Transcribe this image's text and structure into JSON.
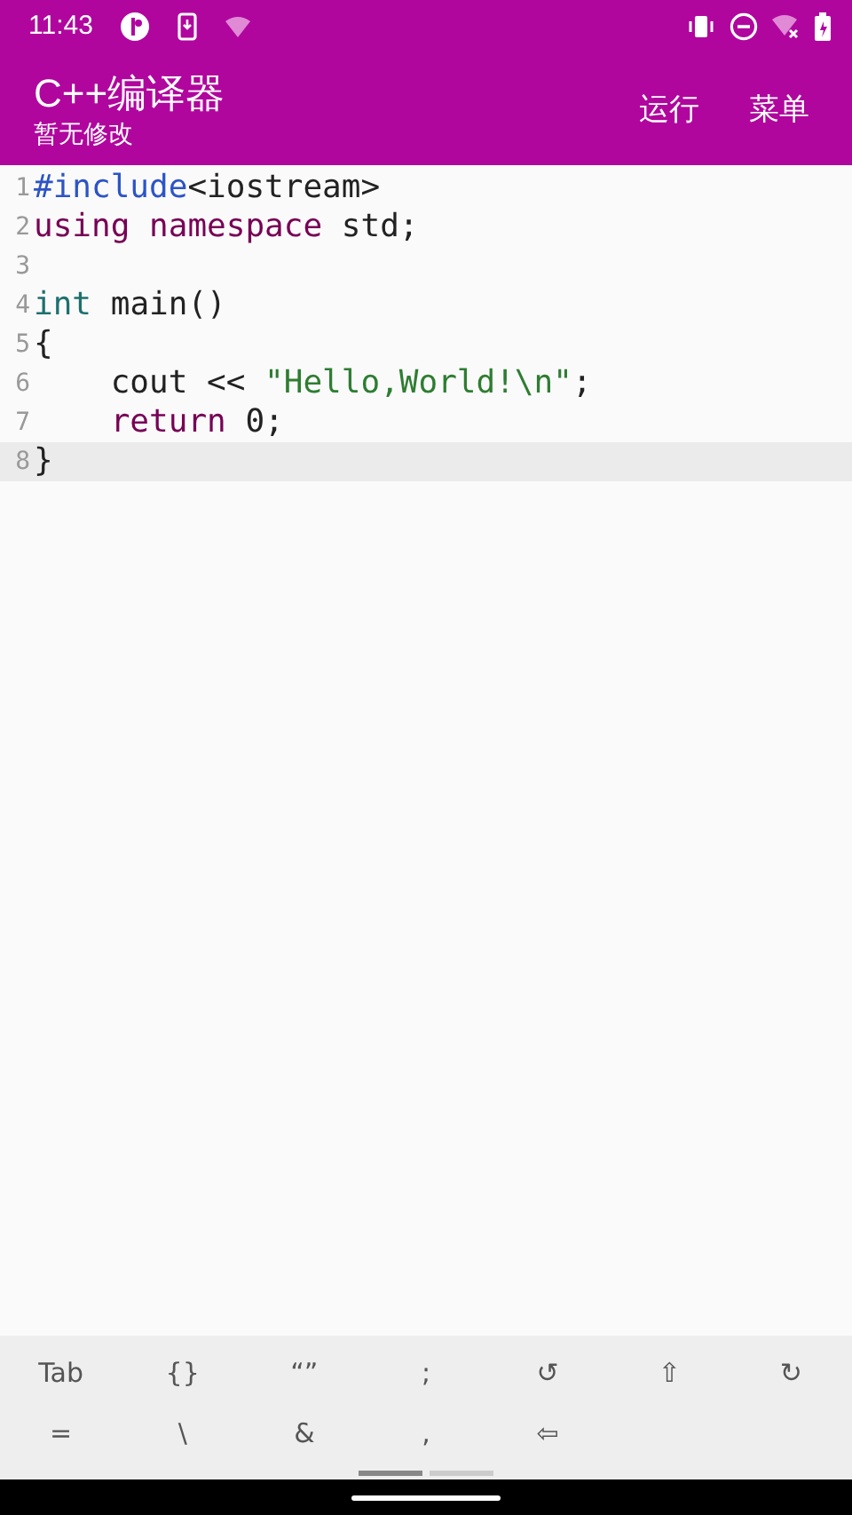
{
  "status_bar": {
    "time": "11:43"
  },
  "app_bar": {
    "title": "C++编译器",
    "subtitle": "暂无修改",
    "actions": [
      "运行",
      "菜单"
    ]
  },
  "editor": {
    "lines": [
      {
        "number": "1",
        "current": false,
        "indented": false,
        "tokens": [
          {
            "kind": "directive",
            "text": "#include"
          },
          {
            "kind": "plain",
            "text": "<iostream>"
          }
        ]
      },
      {
        "number": "2",
        "current": false,
        "indented": false,
        "tokens": [
          {
            "kind": "keyword",
            "text": "using "
          },
          {
            "kind": "keyword",
            "text": "namespace "
          },
          {
            "kind": "plain",
            "text": "std;"
          }
        ]
      },
      {
        "number": "3",
        "current": false
      },
      {
        "number": "4",
        "current": false,
        "indented": false,
        "tokens": [
          {
            "kind": "type",
            "text": "int"
          },
          {
            "kind": "plain",
            "text": " main()"
          }
        ]
      },
      {
        "number": "5",
        "current": false,
        "indented": false,
        "tokens": [
          {
            "kind": "plain",
            "text": "{"
          }
        ]
      },
      {
        "number": "6",
        "current": false,
        "indented": true,
        "tokens": [
          {
            "kind": "plain",
            "text": "cout << "
          },
          {
            "kind": "string",
            "text": "\"Hello,World!\\n\""
          },
          {
            "kind": "plain",
            "text": ";"
          }
        ]
      },
      {
        "number": "7",
        "current": false,
        "indented": true,
        "tokens": [
          {
            "kind": "keyword",
            "text": "return "
          },
          {
            "kind": "plain",
            "text": "0;"
          }
        ]
      },
      {
        "number": "8",
        "current": true,
        "indented": false,
        "tokens": [
          {
            "kind": "plain",
            "text": "}"
          }
        ]
      }
    ]
  },
  "symbol_bar": {
    "rows": [
      [
        "Tab",
        "{}",
        "“”",
        ";",
        "↺",
        "⇧",
        "↻"
      ],
      [
        "=",
        "\\",
        "&",
        ",",
        "⇦"
      ]
    ],
    "pages": [
      {
        "selected": true
      },
      {
        "selected": false
      }
    ]
  }
}
